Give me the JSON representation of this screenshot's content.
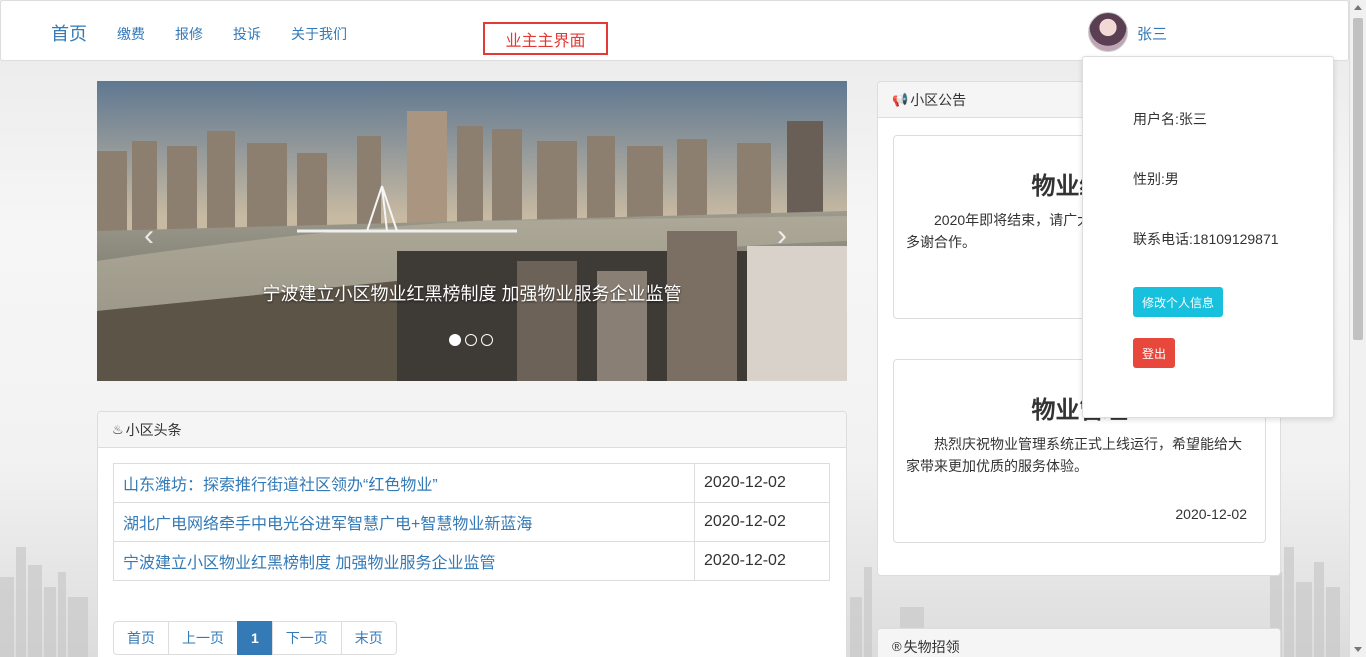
{
  "navbar": {
    "brand": "首页",
    "links": [
      "缴费",
      "报修",
      "投诉",
      "关于我们"
    ],
    "page_label": "业主主界面",
    "user_name": "张三"
  },
  "carousel": {
    "caption": "宁波建立小区物业红黑榜制度 加强物业服务企业监管",
    "prev": "‹",
    "next": "›",
    "slide_count": 3,
    "active_index": 0
  },
  "news": {
    "heading": "小区头条",
    "rows": [
      {
        "title": "山东潍坊：探索推行街道社区领办“红色物业”",
        "date": "2020-12-02"
      },
      {
        "title": "湖北广电网络牵手中电光谷进军智慧广电+智慧物业新蓝海",
        "date": "2020-12-02"
      },
      {
        "title": "宁波建立小区物业红黑榜制度 加强物业服务企业监管",
        "date": "2020-12-02"
      }
    ],
    "pager": [
      "首页",
      "上一页",
      "1",
      "下一页",
      "末页"
    ]
  },
  "notices": {
    "heading": "小区公告",
    "cards": [
      {
        "title": "物业缴费",
        "body": "2020年即将结束，请广大业主及时缴纳物业费用，多谢合作。",
        "date": ""
      },
      {
        "title": "物业管理",
        "body": "热烈庆祝物业管理系统正式上线运行，希望能给大家带来更加优质的服务体验。",
        "date": "2020-12-02"
      }
    ]
  },
  "lost_found": {
    "heading": "失物招领"
  },
  "user_dropdown": {
    "username": "用户名:张三",
    "gender": "性别:男",
    "phone": "联系电话:18109129871",
    "edit_button": "修改个人信息",
    "logout_button": "登出"
  },
  "colors": {
    "link": "#337ab7",
    "accent_red": "#e53935",
    "info": "#17c0dd",
    "danger": "#e8473b"
  }
}
